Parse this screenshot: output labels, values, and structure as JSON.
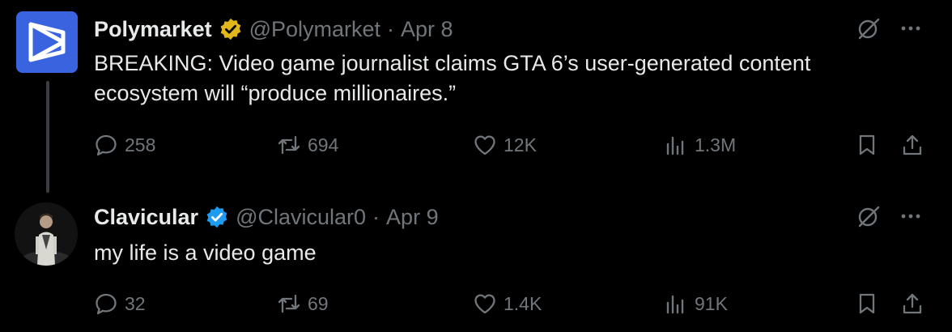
{
  "tweets": [
    {
      "name": "Polymarket",
      "handle": "@Polymarket",
      "separator": "·",
      "date": "Apr 8",
      "badge_color": "#e2b719",
      "text": "BREAKING: Video game journalist claims GTA 6’s user-generated content ecosystem will “produce millionaires.”",
      "stats": {
        "replies": "258",
        "retweets": "694",
        "likes": "12K",
        "views": "1.3M"
      },
      "avatar_icon": "polymarket-logo"
    },
    {
      "name": "Clavicular",
      "handle": "@Clavicular0",
      "separator": "·",
      "date": "Apr 9",
      "badge_color": "#1d9bf0",
      "text": "my life is a video game",
      "stats": {
        "replies": "32",
        "retweets": "69",
        "likes": "1.4K",
        "views": "91K"
      },
      "avatar_icon": "profile-photo"
    }
  ],
  "icons": {
    "grok": "grok-icon",
    "more": "more-icon",
    "reply": "reply-icon",
    "retweet": "retweet-icon",
    "like": "heart-icon",
    "views": "views-icon",
    "bookmark": "bookmark-icon",
    "share": "share-icon"
  },
  "colors": {
    "background": "#000000",
    "text": "#e7e9ea",
    "muted": "#71767b",
    "thread_line": "#3a3d41",
    "polymarket_blue": "#3a63e0"
  }
}
